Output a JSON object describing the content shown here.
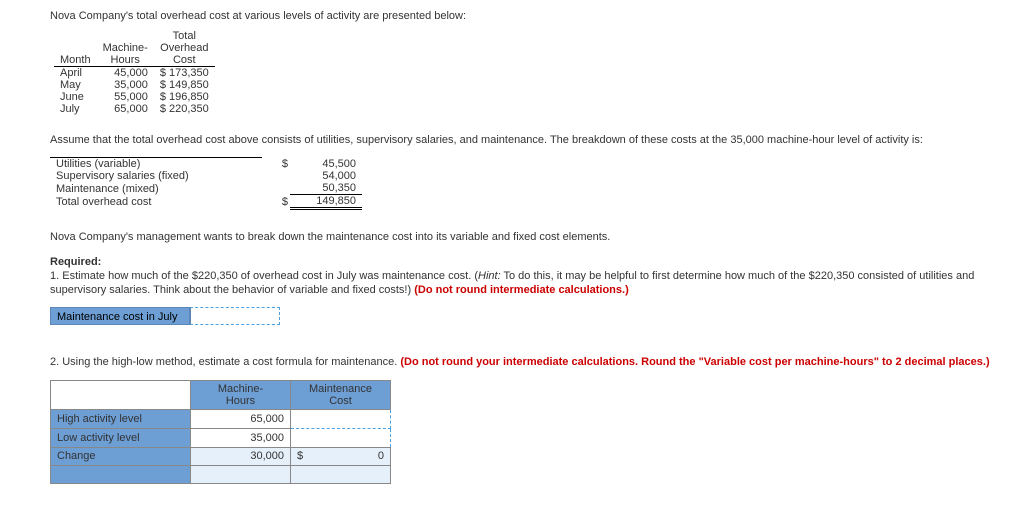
{
  "intro1": "Nova Company's total overhead cost at various levels of activity are presented below:",
  "table1": {
    "head_month": "Month",
    "head_hours_1": "Machine-",
    "head_hours_2": "Hours",
    "head_cost_1": "Total",
    "head_cost_2": "Overhead",
    "head_cost_3": "Cost",
    "rows": [
      {
        "m": "April",
        "h": "45,000",
        "c": "$ 173,350"
      },
      {
        "m": "May",
        "h": "35,000",
        "c": "$ 149,850"
      },
      {
        "m": "June",
        "h": "55,000",
        "c": "$ 196,850"
      },
      {
        "m": "July",
        "h": "65,000",
        "c": "$ 220,350"
      }
    ]
  },
  "intro2": "Assume that the total overhead cost above consists of utilities, supervisory salaries, and maintenance. The breakdown of these costs at the 35,000 machine-hour level of activity is:",
  "table2": {
    "rows": [
      {
        "l": "Utilities (variable)",
        "s": "$",
        "v": "45,500"
      },
      {
        "l": "Supervisory salaries (fixed)",
        "s": "",
        "v": "54,000"
      },
      {
        "l": "Maintenance (mixed)",
        "s": "",
        "v": "50,350"
      },
      {
        "l": "Total overhead cost",
        "s": "$",
        "v": "149,850"
      }
    ]
  },
  "intro3": "Nova Company's management wants to break down the maintenance cost into its variable and fixed cost elements.",
  "required_label": "Required:",
  "req1_a": "1. Estimate how much of the $220,350 of overhead cost in July was maintenance cost. (",
  "req1_hint_label": "Hint:",
  "req1_b": " To do this, it may be helpful to first determine how much of the $220,350 consisted of utilities and supervisory salaries. Think about the behavior of variable and fixed costs!) ",
  "req1_red": "(Do not round intermediate calculations.)",
  "answer1_label": "Maintenance cost in July",
  "answer1_value": "",
  "req2_a": "2. Using the high-low method, estimate a cost formula for maintenance. ",
  "req2_red": "(Do not round your intermediate calculations. Round the \"Variable cost per machine-hours\" to 2 decimal places.)",
  "hl": {
    "head_hours": "Machine-\nHours",
    "head_cost": "Maintenance\nCost",
    "high_label": "High activity level",
    "high_hours": "65,000",
    "high_cost": "",
    "low_label": "Low activity level",
    "low_hours": "35,000",
    "low_cost": "",
    "change_label": "Change",
    "change_hours": "30,000",
    "change_sym": "$",
    "change_cost": "0"
  }
}
